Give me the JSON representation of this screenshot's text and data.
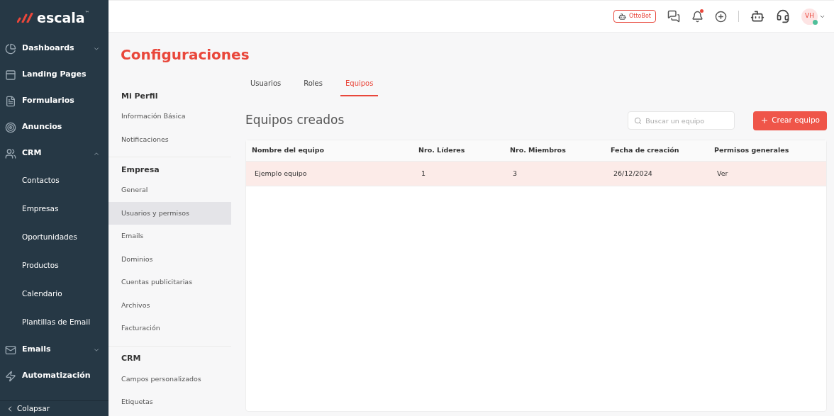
{
  "logo": {
    "text": "escala",
    "mark": "™"
  },
  "sidebar": {
    "items": [
      {
        "label": "Dashboards",
        "kind": "group",
        "expanded": false
      },
      {
        "label": "Landing Pages",
        "kind": "link"
      },
      {
        "label": "Formularios",
        "kind": "link"
      },
      {
        "label": "Anuncios",
        "kind": "link"
      },
      {
        "label": "CRM",
        "kind": "group",
        "expanded": true,
        "children": [
          {
            "label": "Contactos"
          },
          {
            "label": "Empresas"
          },
          {
            "label": "Oportunidades"
          },
          {
            "label": "Productos"
          },
          {
            "label": "Calendario"
          },
          {
            "label": "Plantillas de Email"
          }
        ]
      },
      {
        "label": "Emails",
        "kind": "group",
        "expanded": false
      },
      {
        "label": "Automatización",
        "kind": "link"
      }
    ],
    "collapse": "Colapsar"
  },
  "topbar": {
    "ottobot": "OttoBot",
    "notification_unread": true,
    "avatar": "VH",
    "online": true
  },
  "page_title": "Configuraciones",
  "settings_nav": [
    {
      "heading": "Mi Perfil",
      "items": [
        {
          "label": "Información Básica",
          "selected": false
        },
        {
          "label": "Notificaciones",
          "selected": false
        }
      ]
    },
    {
      "heading": "Empresa",
      "items": [
        {
          "label": "General",
          "selected": false
        },
        {
          "label": "Usuarios y permisos",
          "selected": true
        },
        {
          "label": "Emails",
          "selected": false
        },
        {
          "label": "Dominios",
          "selected": false
        },
        {
          "label": "Cuentas publicitarias",
          "selected": false
        },
        {
          "label": "Archivos",
          "selected": false
        },
        {
          "label": "Facturación",
          "selected": false
        }
      ]
    },
    {
      "heading": "CRM",
      "items": [
        {
          "label": "Campos personalizados",
          "selected": false
        },
        {
          "label": "Etiquetas",
          "selected": false
        }
      ]
    }
  ],
  "tabs": [
    {
      "label": "Usuarios",
      "selected": false
    },
    {
      "label": "Roles",
      "selected": false
    },
    {
      "label": "Equipos",
      "selected": true
    }
  ],
  "section_title": "Equipos creados",
  "search": {
    "placeholder": "Buscar un equipo"
  },
  "create_button": "Crear equipo",
  "table": {
    "columns": [
      "Nombre del equipo",
      "Nro. Líderes",
      "Nro. Miembros",
      "Fecha de creación",
      "Permisos generales"
    ],
    "rows": [
      {
        "cells": [
          "Ejemplo equipo",
          "1",
          "3",
          "26/12/2024",
          "Ver"
        ],
        "selected": true
      }
    ]
  }
}
